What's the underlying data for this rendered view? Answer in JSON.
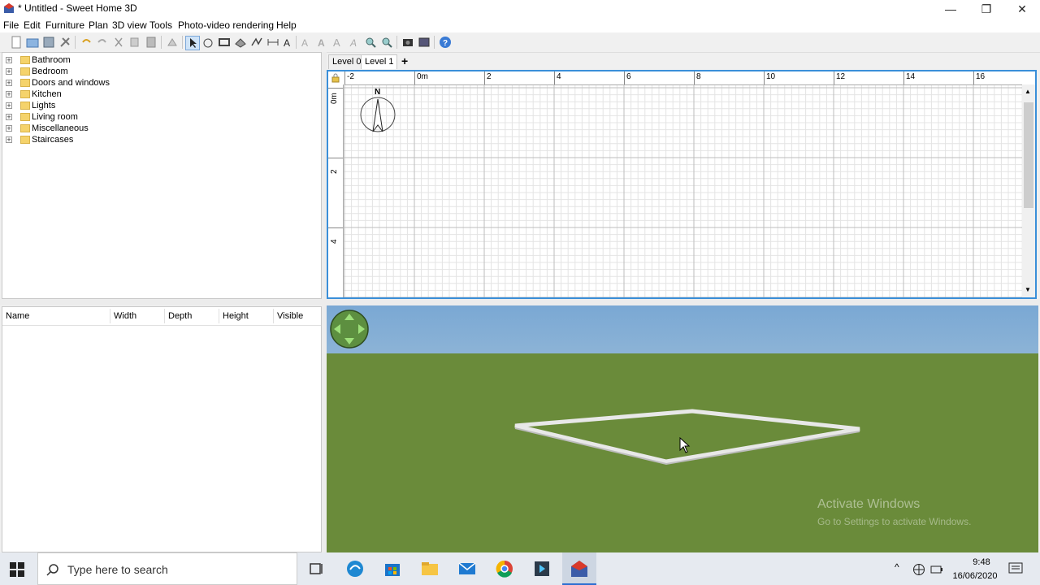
{
  "window": {
    "title": "* Untitled - Sweet Home 3D",
    "minimize_glyph": "—",
    "maximize_glyph": "❐",
    "close_glyph": "✕"
  },
  "menu": [
    "File",
    "Edit",
    "Furniture",
    "Plan",
    "3D view",
    "Tools",
    "Photo-video rendering",
    "Help"
  ],
  "catalog": {
    "categories": [
      "Bathroom",
      "Bedroom",
      "Doors and windows",
      "Kitchen",
      "Lights",
      "Living room",
      "Miscellaneous",
      "Staircases"
    ]
  },
  "furniture_table": {
    "columns": [
      "Name",
      "Width",
      "Depth",
      "Height",
      "Visible"
    ]
  },
  "plan": {
    "levels": [
      "Level 0",
      "Level 1"
    ],
    "add_level_glyph": "+",
    "ruler_top": [
      "-2",
      "0m",
      "2",
      "4",
      "6",
      "8",
      "10",
      "12",
      "14",
      "16"
    ],
    "ruler_left": [
      "0m",
      "2",
      "4"
    ],
    "compass_label": "N"
  },
  "watermark": {
    "line1": "Activate Windows",
    "line2": "Go to Settings to activate Windows."
  },
  "taskbar": {
    "search_placeholder": "Type here to search",
    "time": "9:48",
    "date": "16/06/2020"
  },
  "colors": {
    "plan_border": "#3a8fd9",
    "sky": "#7aa8d4",
    "ground": "#6a8b3a"
  }
}
